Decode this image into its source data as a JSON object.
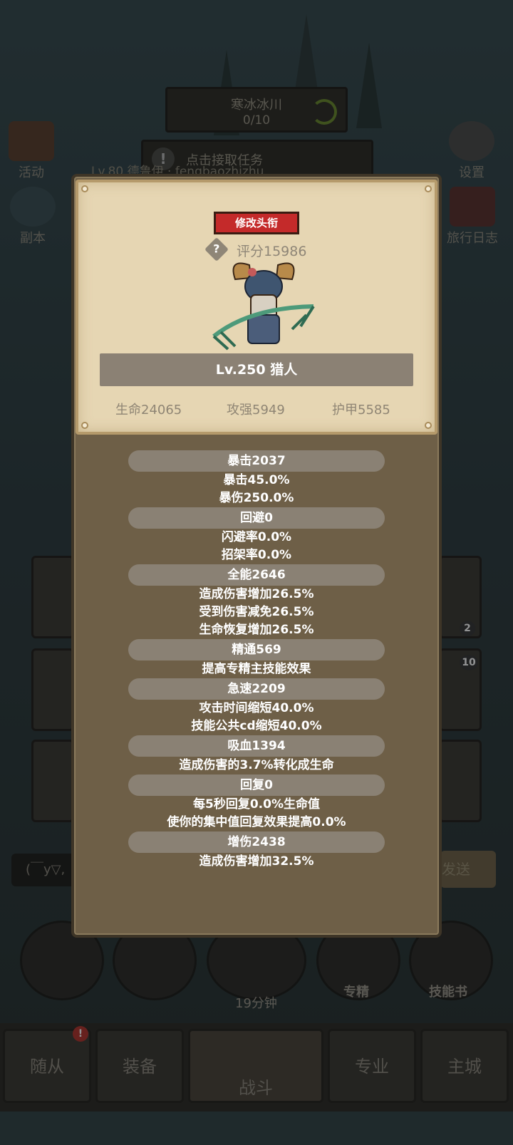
{
  "background": {
    "region": {
      "name": "寒冰冰川",
      "progress": "0/10"
    },
    "quest": {
      "title": "点击接取任务",
      "subtitle": "Lv.80 德鲁伊 · fengbaozhizhu"
    },
    "left_buttons": [
      {
        "label": "活动"
      },
      {
        "label": "副本"
      }
    ],
    "right_buttons": [
      {
        "label": "设置"
      },
      {
        "label": "旅行日志"
      }
    ],
    "chat": {
      "input_value": "(￣y▽,",
      "send_label": "发送"
    },
    "slot_badges": [
      "2",
      "10"
    ],
    "round_buttons": {
      "chest_timer": "19分钟",
      "spec_label": "专精",
      "skillbook_label": "技能书"
    },
    "tabs": [
      {
        "label": "随从",
        "badge": "!"
      },
      {
        "label": "装备"
      },
      {
        "label": "战斗"
      },
      {
        "label": "专业"
      },
      {
        "label": "主城"
      }
    ]
  },
  "profile": {
    "edit_title_label": "修改头衔",
    "score": "评分15986",
    "level_class": "Lv.250 猎人",
    "hp": "生命24065",
    "attack": "攻强5949",
    "armor": "护甲5585"
  },
  "attributes": [
    {
      "header": "暴击2037",
      "lines": [
        "暴击45.0%",
        "暴伤250.0%"
      ]
    },
    {
      "header": "回避0",
      "lines": [
        "闪避率0.0%",
        "招架率0.0%"
      ]
    },
    {
      "header": "全能2646",
      "lines": [
        "造成伤害增加26.5%",
        "受到伤害减免26.5%",
        "生命恢复增加26.5%"
      ]
    },
    {
      "header": "精通569",
      "lines": [
        "提高专精主技能效果"
      ]
    },
    {
      "header": "急速2209",
      "lines": [
        "攻击时间缩短40.0%",
        "技能公共cd缩短40.0%"
      ]
    },
    {
      "header": "吸血1394",
      "lines": [
        "造成伤害的3.7%转化成生命"
      ]
    },
    {
      "header": "回复0",
      "lines": [
        "每5秒回复0.0%生命值",
        "使你的集中值回复效果提高0.0%"
      ]
    },
    {
      "header": "增伤2438",
      "lines": [
        "造成伤害增加32.5%"
      ]
    }
  ],
  "colors": {
    "accent_red": "#c42a2a",
    "parchment": "#e6d6b3",
    "panel": "#6e5f47"
  }
}
